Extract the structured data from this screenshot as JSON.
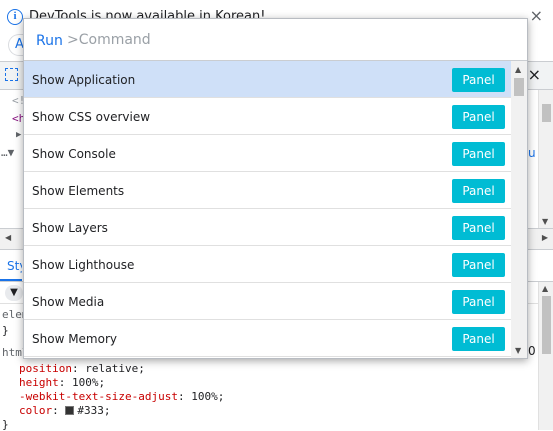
{
  "infobar": {
    "message": "DevTools is now available in Korean!",
    "icon": "info-icon",
    "close_glyph": "×",
    "pill_text": "A"
  },
  "toolbar": {
    "close_glyph": "×"
  },
  "elements": {
    "lines": [
      "<!",
      "<h",
      "▶",
      "…▼"
    ],
    "badge": "u"
  },
  "styles": {
    "tab_label": "Sty",
    "filter_glyph": "▼",
    "lines": {
      "l1": "elem",
      "l2": "}",
      "l3": "html",
      "position": {
        "prop": "position",
        "value": "relative;"
      },
      "height": {
        "prop": "height",
        "value": "100%;"
      },
      "webkit": {
        "prop": "-webkit-text-size-adjust",
        "value": "100%;"
      },
      "color": {
        "prop": "color",
        "value": "#333;"
      },
      "close": "}"
    },
    "side_value": "0"
  },
  "command_menu": {
    "prefix": "Run",
    "input_value": "",
    "placeholder": ">Command",
    "items": [
      {
        "label": "Show Application",
        "tag": "Panel",
        "selected": true
      },
      {
        "label": "Show CSS overview",
        "tag": "Panel"
      },
      {
        "label": "Show Console",
        "tag": "Panel"
      },
      {
        "label": "Show Elements",
        "tag": "Panel"
      },
      {
        "label": "Show Layers",
        "tag": "Panel"
      },
      {
        "label": "Show Lighthouse",
        "tag": "Panel"
      },
      {
        "label": "Show Media",
        "tag": "Panel"
      },
      {
        "label": "Show Memory",
        "tag": "Panel"
      }
    ]
  },
  "colors": {
    "accent": "#1a73e8",
    "panel_tag": "#00bcd4",
    "selected_row": "#cfe0f8",
    "css_property": "#c80000"
  }
}
